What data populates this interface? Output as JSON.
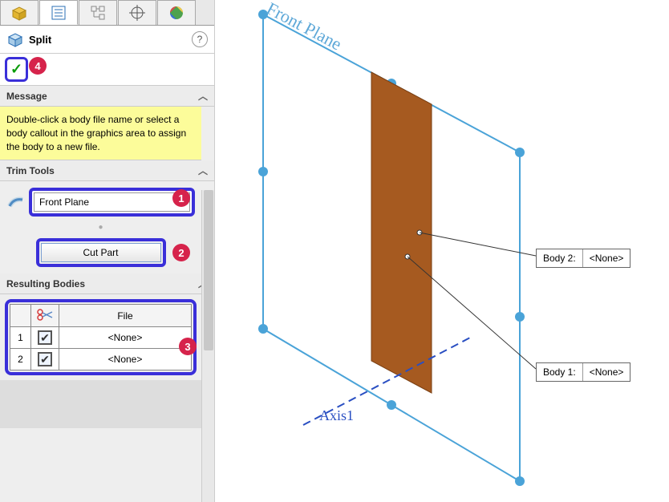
{
  "header": {
    "title": "Split"
  },
  "confirm": {
    "badge": "4"
  },
  "message": {
    "header": "Message",
    "text": "Double-click a body file name or select a body callout in the graphics area to assign the body to a new file."
  },
  "trim": {
    "header": "Trim Tools",
    "input_value": "Front Plane",
    "badge1": "1",
    "cut_label": "Cut Part",
    "badge2": "2"
  },
  "resulting": {
    "header": "Resulting Bodies",
    "col_file": "File",
    "rows": [
      {
        "idx": "1",
        "file": "<None>"
      },
      {
        "idx": "2",
        "file": "<None>"
      }
    ],
    "badge3": "3"
  },
  "viewport": {
    "plane_label": "Front Plane",
    "axis_label": "Axis1",
    "callouts": [
      {
        "label": "Body 2:",
        "value": "<None>"
      },
      {
        "label": "Body 1:",
        "value": "<None>"
      }
    ]
  }
}
